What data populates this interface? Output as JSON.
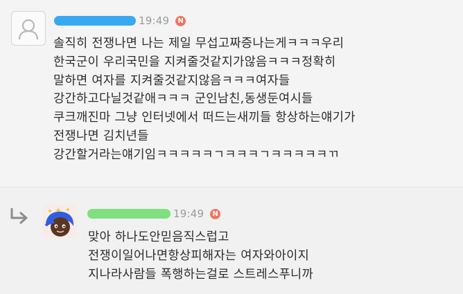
{
  "colors": {
    "badge": "#f07560",
    "name_highlight_post": "#38a8f0",
    "name_highlight_reply": "#7fe07f"
  },
  "post": {
    "avatar_icon": "default-user-icon",
    "time": "19:49",
    "badge": "N",
    "lines": [
      "솔직히 전쟁나면 나는 제일 무섭고짜증나는게ㅋㅋㅋ우리",
      "한국군이 우리국민을 지켜줄것같지가않음ㅋㅋㅋ정확히",
      "말하면 여자를 지켜줄것같지않음ㅋㅋㅋ여자들",
      "강간하고다닐것같애ㅋㅋㅋ 군인남친,동생둔여시들",
      "쿠크깨진마 그냥 인터넷에서 떠드는새끼들 항상하는얘기가",
      "전쟁나면 김치년들",
      "강간할거라는얘기임ㅋㅋㅋㅋㅋㄱㅋㅋㅋㄱㅋㅋㅋㅋㅋㄲ"
    ]
  },
  "reply": {
    "reply_icon": "reply-arrow-icon",
    "avatar_icon": "profile-photo",
    "time": "19:49",
    "badge": "N",
    "lines": [
      "맞아 하나도안믿음직스럽고",
      "전쟁이일어나면항상피해자는 여자와아이지",
      "지나라사람들 폭행하는걸로 스트레스푸니까"
    ]
  }
}
